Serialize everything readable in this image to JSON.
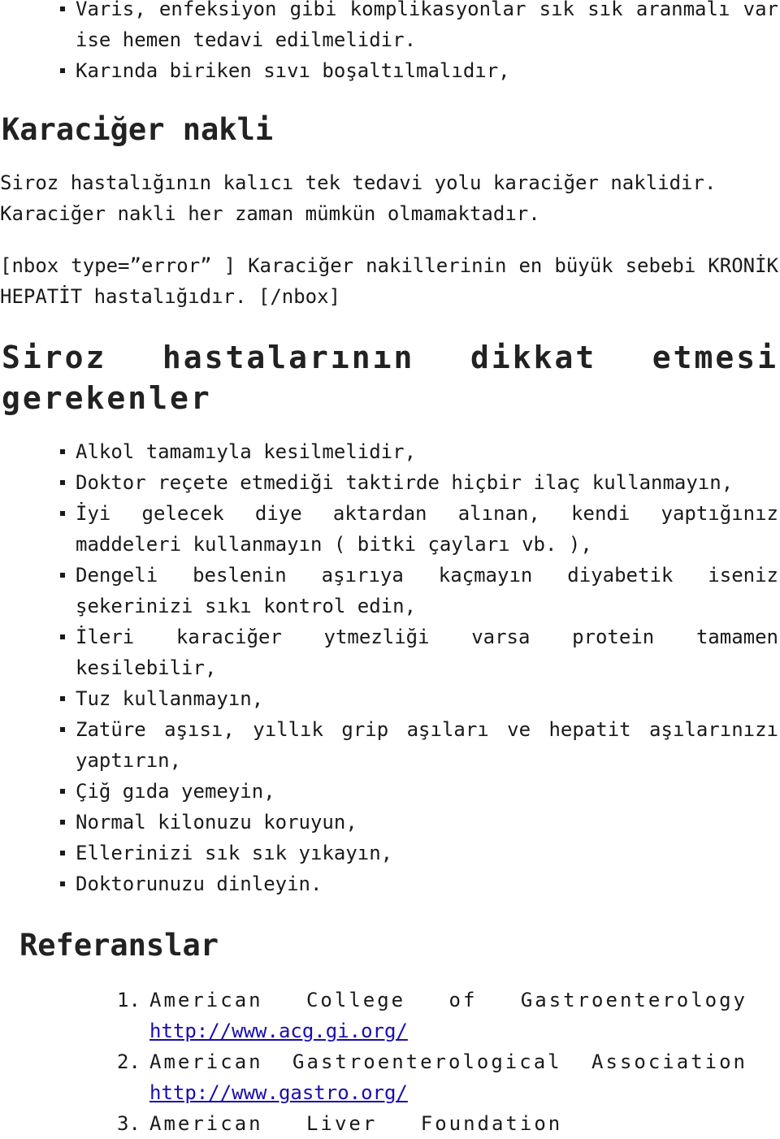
{
  "top_list": [
    "Varis, enfeksiyon gibi komplikasyonlar sık sık aranmalı var ise hemen tedavi edilmelidir.",
    "Karında biriken sıvı boşaltılmalıdır,"
  ],
  "section_transplant": {
    "heading": "Karaciğer nakli",
    "paragraph": "Siroz hastalığının kalıcı tek tedavi yolu karaciğer naklidir. Karaciğer nakli her zaman mümkün olmamaktadır.",
    "nbox": "[nbox type=”error” ]  Karaciğer nakillerinin en büyük sebebi KRONİK HEPATİT hastalığıdır. [/nbox]"
  },
  "section_advice": {
    "heading": "Siroz hastalarının dikkat etmesi gerekenler",
    "items": [
      "Alkol tamamıyla kesilmelidir,",
      "Doktor reçete etmediği taktirde hiçbir ilaç kullanmayın,",
      "İyi gelecek diye aktardan alınan, kendi yaptığınız maddeleri kullanmayın ( bitki çayları vb. ),",
      "Dengeli beslenin aşırıya kaçmayın diyabetik iseniz şekerinizi sıkı kontrol edin,",
      "İleri karaciğer ytmezliği varsa protein tamamen kesilebilir,",
      "Tuz kullanmayın,",
      "Zatüre aşısı, yıllık grip aşıları ve hepatit aşılarınızı yaptırın,",
      "Çiğ gıda yemeyin,",
      "Normal kilonuzu koruyun,",
      "Ellerinizi sık sık yıkayın,",
      "Doktorunuzu dinleyin."
    ]
  },
  "references": {
    "heading": "Referanslar",
    "items": [
      {
        "num": "1.",
        "title": "American College of Gastroenterology",
        "url": "http://www.acg.gi.org/"
      },
      {
        "num": "2.",
        "title": "American Gastroenterological Association",
        "url": "http://www.gastro.org/"
      },
      {
        "num": "3.",
        "title": "American Liver Foundation",
        "url": ""
      }
    ]
  },
  "colors": {
    "text": "#1a1a1a",
    "link": "#1a0dab",
    "background": "#ffffff"
  }
}
